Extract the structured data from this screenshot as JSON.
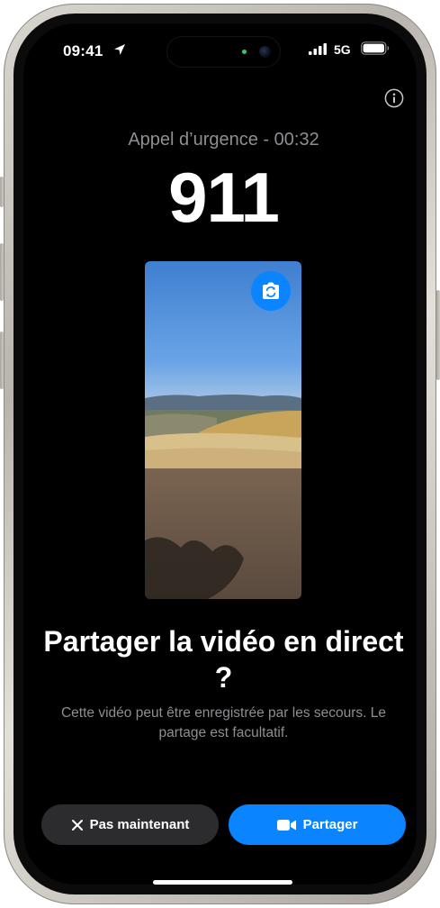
{
  "status_bar": {
    "time": "09:41",
    "network": "5G"
  },
  "call": {
    "subtitle": "Appel d’urgence - 00:32",
    "number": "911"
  },
  "video_preview": {
    "flip_icon": "camera-flip-icon"
  },
  "prompt": {
    "title": "Partager la vidéo en direct ?",
    "description": "Cette vidéo peut être enregistrée par les secours. Le partage est facultatif."
  },
  "actions": {
    "decline_label": "Pas maintenant",
    "share_label": "Partager"
  },
  "colors": {
    "accent": "#0a84ff",
    "secondary_button": "#2c2c2e",
    "secondary_text": "#8e8e93"
  }
}
